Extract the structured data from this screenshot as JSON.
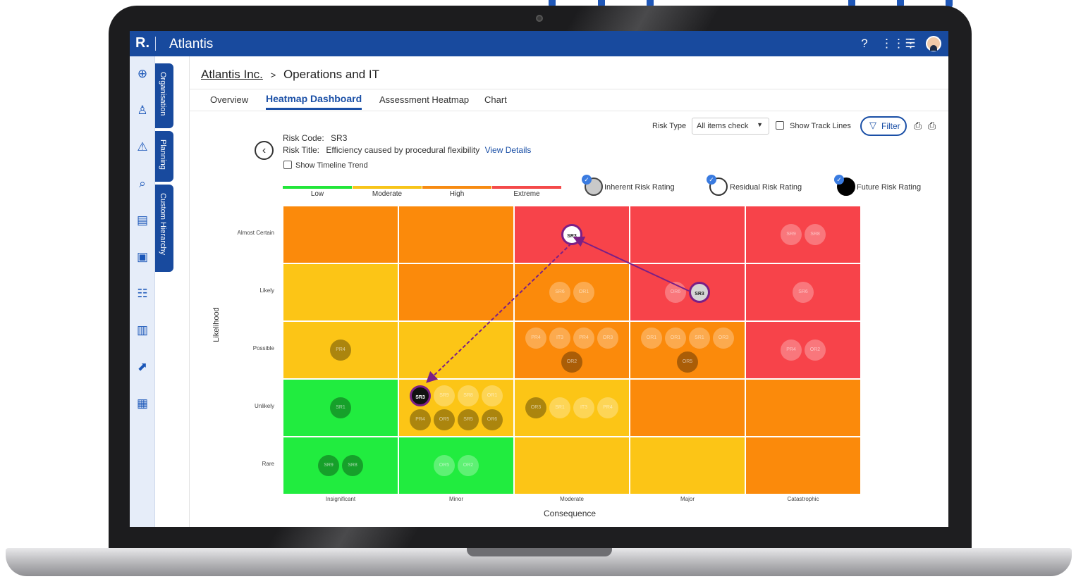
{
  "app": {
    "logo": "R.",
    "title": "Atlantis"
  },
  "topbar_icons": [
    "help-icon",
    "apps-grid-icon",
    "menu-icon",
    "user-avatar"
  ],
  "rail_icons": [
    "add-circle-icon",
    "users-icon",
    "warning-icon",
    "search-settings-icon",
    "document-icon",
    "shield-document-icon",
    "list-settings-icon",
    "report-chart-icon",
    "trend-chart-icon",
    "image-report-icon"
  ],
  "vertical_tabs": [
    "Organisation",
    "Planning",
    "Custom Hierarchy"
  ],
  "breadcrumb": {
    "root": "Atlantis Inc.",
    "separator": ">",
    "current": "Operations and IT"
  },
  "tabs": [
    "Overview",
    "Heatmap Dashboard",
    "Assessment Heatmap",
    "Chart"
  ],
  "active_tab": "Heatmap Dashboard",
  "controls": {
    "risk_type_label": "Risk Type",
    "risk_type_value": "All items check",
    "show_track_lines": "Show Track Lines",
    "filter": "Filter"
  },
  "risk": {
    "code_label": "Risk Code:",
    "code": "SR3",
    "title_label": "Risk Title:",
    "title": "Efficiency caused by procedural flexibility",
    "view_details": "View Details",
    "show_timeline": "Show Timeline Trend"
  },
  "rating_scale": [
    {
      "label": "Low",
      "color": "#22e63a"
    },
    {
      "label": "Moderate",
      "color": "#f7c51a"
    },
    {
      "label": "High",
      "color": "#f78b12"
    },
    {
      "label": "Extreme",
      "color": "#f44a4a"
    }
  ],
  "legend": {
    "inherent": "Inherent Risk Rating",
    "residual": "Residual Risk Rating",
    "future": "Future Risk Rating"
  },
  "heatmap": {
    "y_axis_label": "Likelihood",
    "x_axis_label": "Consequence",
    "rows": [
      "Almost Certain",
      "Likely",
      "Possible",
      "Unlikely",
      "Rare"
    ],
    "columns": [
      "Insignificant",
      "Minor",
      "Moderate",
      "Major",
      "Catastrophic"
    ],
    "cell_colors": [
      [
        "#fb8a0b",
        "#fb8a0b",
        "#f7434a",
        "#f7434a",
        "#f7434a"
      ],
      [
        "#fcc516",
        "#fb8a0b",
        "#fb8a0b",
        "#f7434a",
        "#f7434a"
      ],
      [
        "#fcc516",
        "#fcc516",
        "#fb8a0b",
        "#fb8a0b",
        "#f7434a"
      ],
      [
        "#21ec3f",
        "#fcc516",
        "#fcc516",
        "#fb8a0b",
        "#fb8a0b"
      ],
      [
        "#21ec3f",
        "#21ec3f",
        "#fcc516",
        "#fcc516",
        "#fb8a0b"
      ]
    ],
    "bubbles": [
      {
        "row": 0,
        "col": 2,
        "items": [
          {
            "code": "SR3",
            "kind": "residual-selected"
          }
        ]
      },
      {
        "row": 0,
        "col": 4,
        "items": [
          {
            "code": "SR9",
            "kind": "faded"
          },
          {
            "code": "SR8",
            "kind": "faded"
          }
        ]
      },
      {
        "row": 1,
        "col": 2,
        "items": [
          {
            "code": "SR6",
            "kind": "faded"
          },
          {
            "code": "OR1",
            "kind": "faded"
          }
        ]
      },
      {
        "row": 1,
        "col": 3,
        "items": [
          {
            "code": "OR6",
            "kind": "faded"
          },
          {
            "code": "SR3",
            "kind": "inherent-selected"
          }
        ]
      },
      {
        "row": 1,
        "col": 4,
        "items": [
          {
            "code": "SR6",
            "kind": "faded"
          }
        ]
      },
      {
        "row": 2,
        "col": 0,
        "items": [
          {
            "code": "PR4",
            "kind": "dark"
          }
        ]
      },
      {
        "row": 2,
        "col": 2,
        "items": [
          {
            "code": "PR4",
            "kind": "faded"
          },
          {
            "code": "IT3",
            "kind": "faded"
          },
          {
            "code": "PR4",
            "kind": "faded"
          },
          {
            "code": "OR3",
            "kind": "faded"
          },
          {
            "code": "OR2",
            "kind": "dark"
          }
        ]
      },
      {
        "row": 2,
        "col": 3,
        "items": [
          {
            "code": "OR1",
            "kind": "faded"
          },
          {
            "code": "OR1",
            "kind": "faded"
          },
          {
            "code": "SR1",
            "kind": "faded"
          },
          {
            "code": "OR3",
            "kind": "faded"
          },
          {
            "code": "OR5",
            "kind": "dark"
          }
        ]
      },
      {
        "row": 2,
        "col": 4,
        "items": [
          {
            "code": "PR4",
            "kind": "faded"
          },
          {
            "code": "OR2",
            "kind": "faded"
          }
        ]
      },
      {
        "row": 3,
        "col": 0,
        "items": [
          {
            "code": "SR1",
            "kind": "dark"
          }
        ]
      },
      {
        "row": 3,
        "col": 1,
        "items": [
          {
            "code": "SR3",
            "kind": "future-selected"
          },
          {
            "code": "SR9",
            "kind": "faded"
          },
          {
            "code": "SR8",
            "kind": "faded"
          },
          {
            "code": "OR1",
            "kind": "faded"
          },
          {
            "code": "PR4",
            "kind": "dark"
          },
          {
            "code": "OR5",
            "kind": "dark"
          },
          {
            "code": "SR5",
            "kind": "dark"
          },
          {
            "code": "OR6",
            "kind": "dark"
          }
        ]
      },
      {
        "row": 3,
        "col": 2,
        "items": [
          {
            "code": "OR3",
            "kind": "dark"
          },
          {
            "code": "SR1",
            "kind": "faded"
          },
          {
            "code": "IT3",
            "kind": "faded"
          },
          {
            "code": "PR4",
            "kind": "faded"
          }
        ]
      },
      {
        "row": 4,
        "col": 0,
        "items": [
          {
            "code": "SR9",
            "kind": "dark"
          },
          {
            "code": "SR8",
            "kind": "dark"
          }
        ]
      },
      {
        "row": 4,
        "col": 1,
        "items": [
          {
            "code": "OR5",
            "kind": "faded"
          },
          {
            "code": "OR2",
            "kind": "faded"
          }
        ]
      }
    ]
  }
}
